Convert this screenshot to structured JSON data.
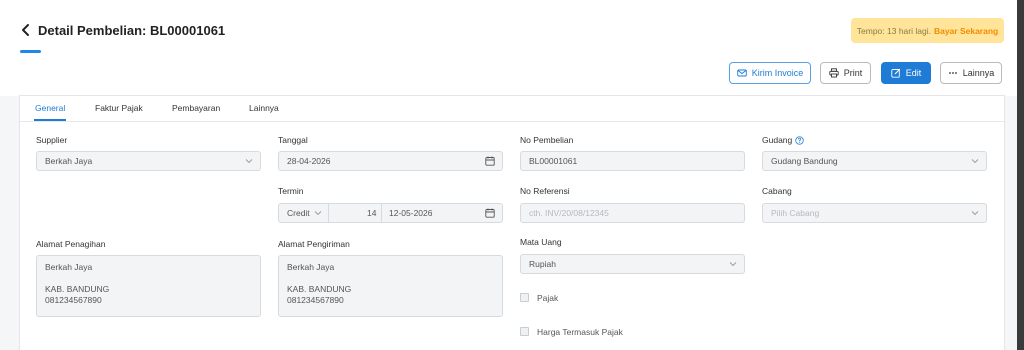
{
  "header": {
    "title": "Detail Pembelian: BL00001061",
    "tempo_text": "Tempo: 13 hari lagi.",
    "tempo_link": "Bayar Sekarang"
  },
  "toolbar": {
    "kirim_invoice": "Kirim Invoice",
    "print": "Print",
    "edit": "Edit",
    "lainnya": "Lainnya"
  },
  "tabs": [
    {
      "label": "General",
      "active": true
    },
    {
      "label": "Faktur Pajak",
      "active": false
    },
    {
      "label": "Pembayaran",
      "active": false
    },
    {
      "label": "Lainnya",
      "active": false
    }
  ],
  "form": {
    "supplier_label": "Supplier",
    "supplier_value": "Berkah Jaya",
    "tanggal_label": "Tanggal",
    "tanggal_value": "28-04-2026",
    "no_pembelian_label": "No Pembelian",
    "no_pembelian_value": "BL00001061",
    "gudang_label": "Gudang",
    "gudang_value": "Gudang Bandung",
    "termin_label": "Termin",
    "termin_type": "Credit",
    "termin_days": "14",
    "termin_date": "12-05-2026",
    "no_referensi_label": "No Referensi",
    "no_referensi_placeholder": "cth. INV/20/08/12345",
    "cabang_label": "Cabang",
    "cabang_placeholder": "Pilih Cabang",
    "alamat_penagihan_label": "Alamat Penagihan",
    "alamat_penagihan": {
      "line1": "Berkah Jaya",
      "line2": "KAB. BANDUNG",
      "line3": "081234567890"
    },
    "alamat_pengiriman_label": "Alamat Pengiriman",
    "alamat_pengiriman": {
      "line1": "Berkah Jaya",
      "line2": "KAB. BANDUNG",
      "line3": "081234567890"
    },
    "mata_uang_label": "Mata Uang",
    "mata_uang_value": "Rupiah",
    "pajak_label": "Pajak",
    "harga_termasuk_pajak_label": "Harga Termasuk Pajak"
  },
  "colors": {
    "accent": "#1e7bd6",
    "tempo_bg": "#ffe49a",
    "tempo_link": "#f08c00"
  }
}
